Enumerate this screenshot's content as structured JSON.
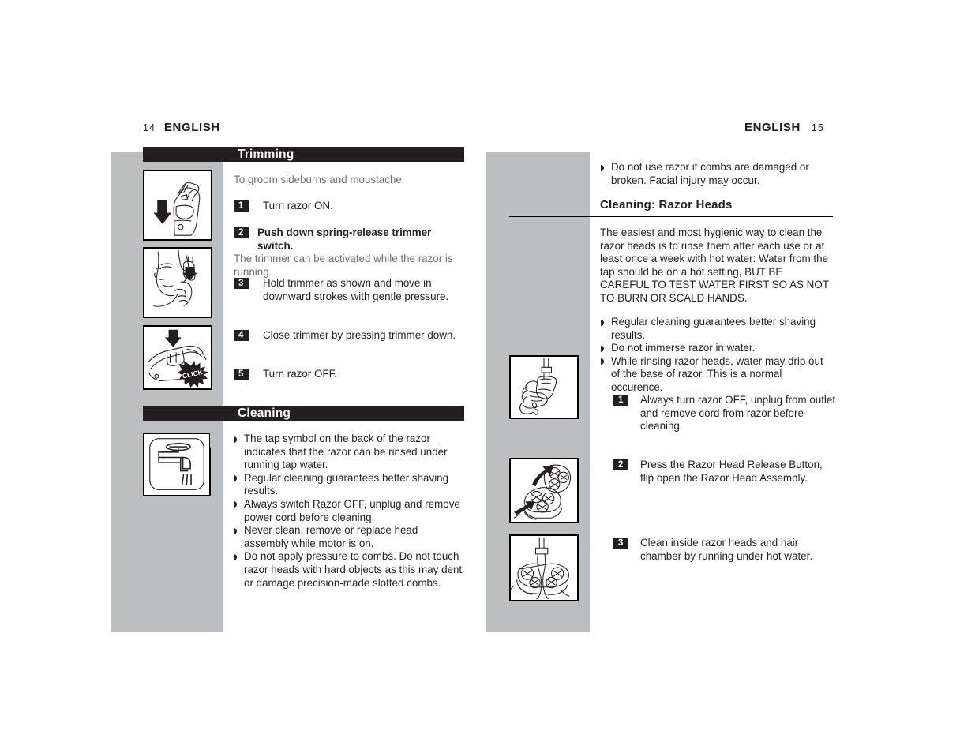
{
  "document": {
    "language": "ENGLISH",
    "spread": "14-15"
  },
  "left_page": {
    "folio": "14",
    "running_head": "ENGLISH",
    "sections": [
      {
        "id": "trimming",
        "bar_title": "Trimming"
      },
      {
        "id": "cleaning",
        "bar_title": "Cleaning"
      }
    ],
    "trimming": {
      "intro": "To groom sideburns and moustache:",
      "steps": [
        {
          "num": "1",
          "text": "Turn razor ON."
        },
        {
          "num": "2",
          "text": "Push down spring-release trimmer switch.",
          "continuation": "The trimmer can be activated while the razor is running."
        },
        {
          "num": "3",
          "text": "Hold trimmer as shown and move in downward strokes with gentle pressure."
        },
        {
          "num": "4",
          "text": "Close trimmer by pressing trimmer down."
        },
        {
          "num": "5",
          "text": "Turn razor OFF."
        }
      ],
      "figures": [
        {
          "id": "fig-razor-trimmer-open",
          "caption": "Razor with trimmer flipped up, down arrow"
        },
        {
          "id": "fig-face-sideburn",
          "caption": "Man trimming sideburn with razor"
        },
        {
          "id": "fig-trimmer-close-click",
          "caption": "Pressing trimmer closed, CLICK burst",
          "burst_label": "CLICK"
        }
      ]
    },
    "cleaning": {
      "bullets": [
        "The tap symbol on the back of the razor indicates that the razor can be rinsed under running tap water.",
        "Regular cleaning guarantees better shaving results.",
        "Always switch Razor OFF, unplug and remove power cord before cleaning.",
        "Never clean, remove or replace head assembly while motor is on.",
        "Do not apply pressure to combs.  Do not touch razor heads with hard objects as this may dent or damage precision-made slotted combs."
      ],
      "figures": [
        {
          "id": "fig-tap-symbol",
          "caption": "Tap / faucet symbol with running water"
        }
      ]
    }
  },
  "right_page": {
    "folio": "15",
    "running_head": "ENGLISH",
    "top_bullets": [
      "Do not use razor if combs are damaged or broken.  Facial injury may occur."
    ],
    "subhead": "Cleaning:  Razor Heads",
    "intro": "The easiest and most hygienic way to clean the razor heads is to rinse them after each use or at least once a week with hot water:  Water from the tap should be on a hot setting, BUT BE CAREFUL TO TEST WATER FIRST SO AS NOT TO BURN OR SCALD HANDS.",
    "bullets": [
      "Regular cleaning guarantees better shaving results.",
      "Do not immerse razor in water.",
      "While rinsing razor heads, water may drip out of the base of razor. This is a normal occurence."
    ],
    "steps": [
      {
        "num": "1",
        "text": "Always turn razor OFF, unplug from outlet and remove cord from razor before cleaning."
      },
      {
        "num": "2",
        "text": "Press the Razor Head Release Button, flip open the Razor Head Assembly."
      },
      {
        "num": "3",
        "text": "Clean inside razor heads and hair chamber by running under hot water."
      }
    ],
    "figures": [
      {
        "id": "fig-hand-rinsing-razor",
        "caption": "Hand holding razor under running tap water"
      },
      {
        "id": "fig-flip-open-head",
        "caption": "Flipping open razor head assembly, arrows"
      },
      {
        "id": "fig-rinse-heads",
        "caption": "Rinsing open razor heads under tap"
      }
    ]
  },
  "colors": {
    "panel_grey": "#bcbec0",
    "bar_black": "#231f20",
    "body_text": "#231f20",
    "muted_text": "#6d6e71",
    "paper": "#ffffff"
  }
}
